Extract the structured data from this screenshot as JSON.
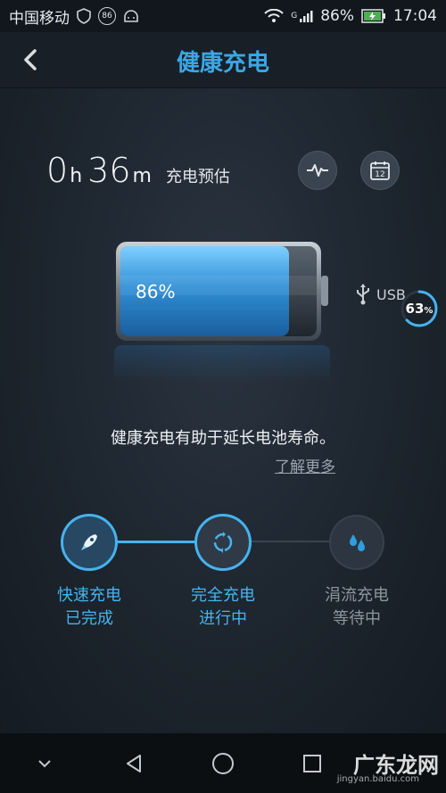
{
  "status_bar": {
    "carrier": "中国移动",
    "badge": "86",
    "signal_type": "G",
    "battery_percent": "86%",
    "time": "17:04"
  },
  "header": {
    "title": "健康充电"
  },
  "estimate": {
    "hours": "0",
    "hours_unit": "h",
    "minutes": "36",
    "minutes_unit": "m",
    "label": "充电预估"
  },
  "battery": {
    "level_percent": 86,
    "label": "86%"
  },
  "usb": {
    "label": "USB",
    "ring_percent": 63,
    "ring_value": "63",
    "ring_suffix": "%"
  },
  "tip": {
    "text": "健康充电有助于延长电池寿命。",
    "link": "了解更多"
  },
  "stages": [
    {
      "title": "快速充电",
      "status": "已完成",
      "state": "done",
      "icon": "rocket-icon"
    },
    {
      "title": "完全充电",
      "status": "进行中",
      "state": "active",
      "icon": "cycle-icon"
    },
    {
      "title": "涓流充电",
      "status": "等待中",
      "state": "waiting",
      "icon": "drops-icon"
    }
  ],
  "colors": {
    "accent": "#46b3ef",
    "title": "#3ba7e6",
    "waiting_text": "#8d969f"
  },
  "watermark": {
    "text": "广东龙网",
    "sub": "jingyan.baidu.com"
  }
}
